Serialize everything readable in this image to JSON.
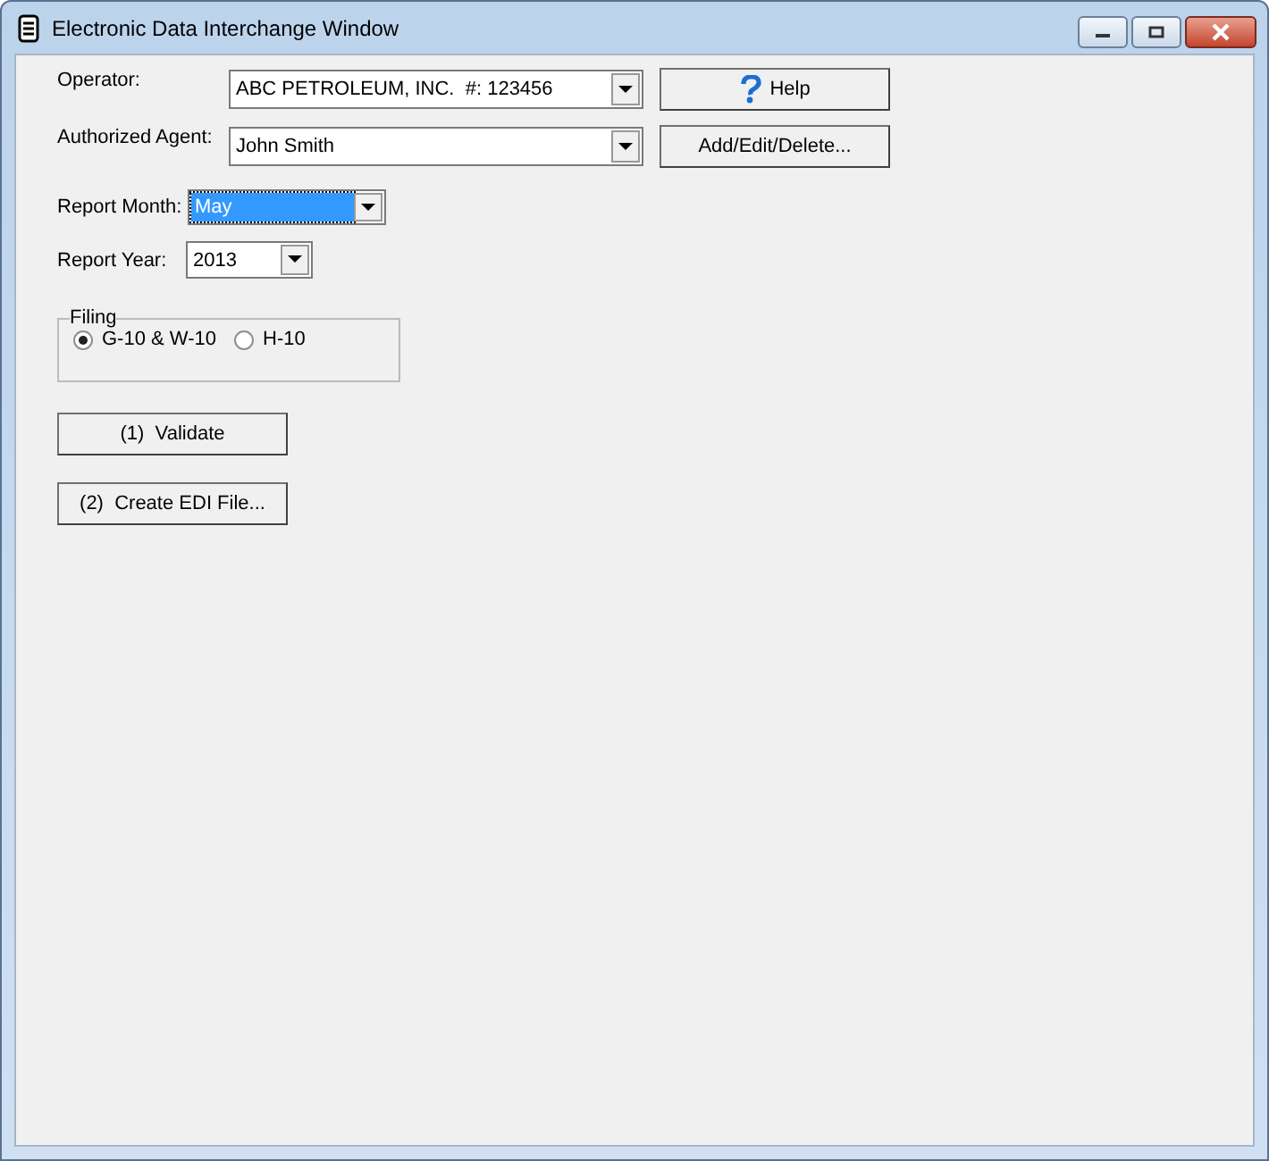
{
  "window": {
    "title": "Electronic Data Interchange Window"
  },
  "operator": {
    "label": "Operator:",
    "value": "ABC PETROLEUM, INC.  #: 123456"
  },
  "help_button": {
    "label": "Help"
  },
  "agent": {
    "label": "Authorized Agent:",
    "value": "John Smith"
  },
  "agent_button": {
    "label": "Add/Edit/Delete..."
  },
  "report_month": {
    "label": "Report Month:",
    "value": "May",
    "focused": true
  },
  "report_year": {
    "label": "Report Year:",
    "value": "2013",
    "focused": false
  },
  "filing": {
    "title": "Filing",
    "options": [
      {
        "label": "G-10 & W-10",
        "selected": true
      },
      {
        "label": "H-10",
        "selected": false
      }
    ]
  },
  "actions": [
    {
      "label": "(1)  Validate"
    },
    {
      "label": "(2)  Create EDI File..."
    }
  ]
}
